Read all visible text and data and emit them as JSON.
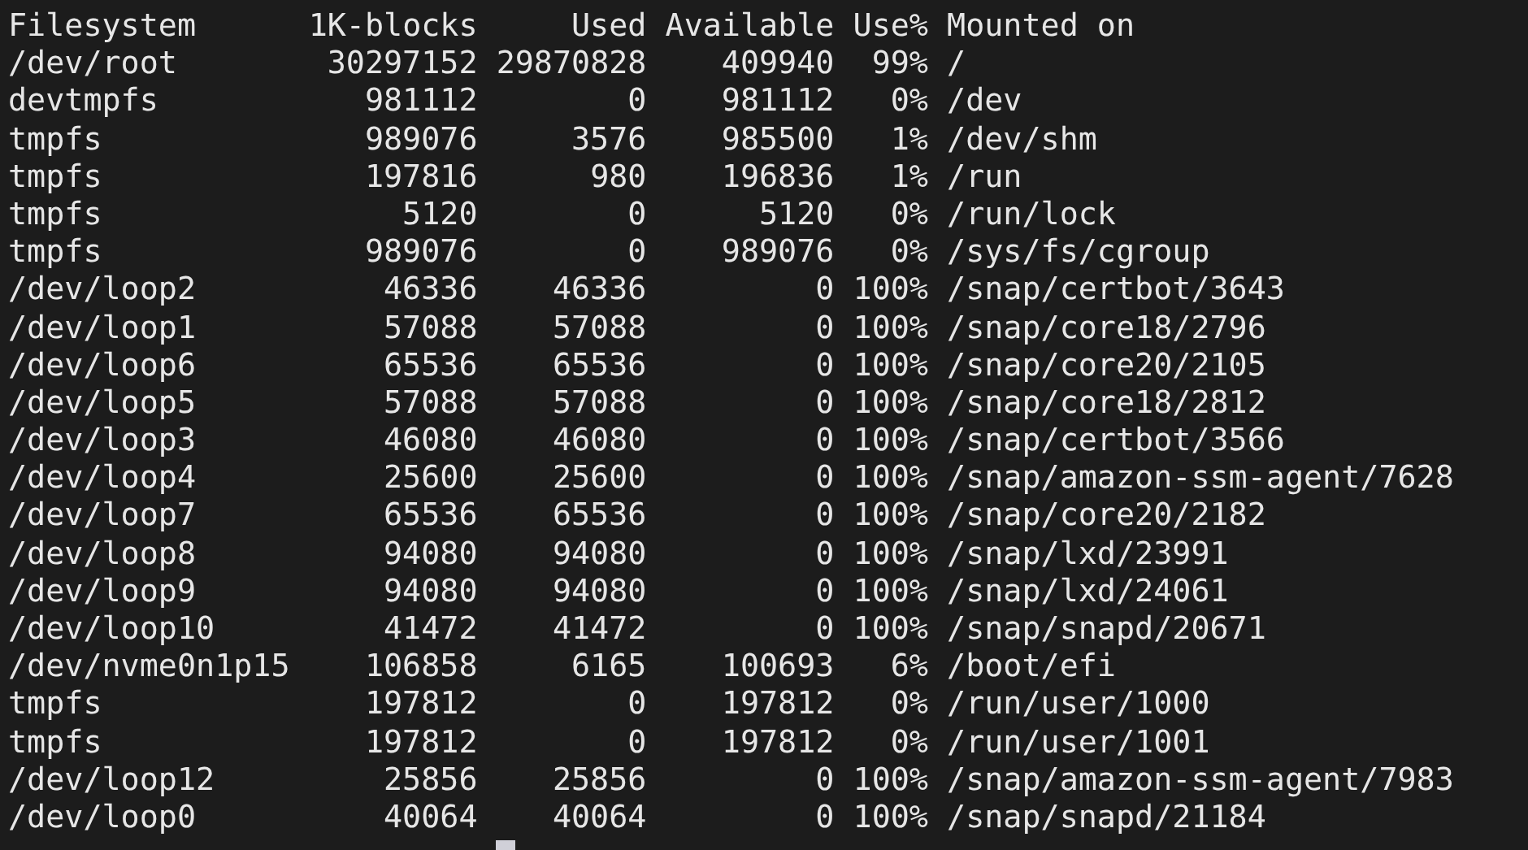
{
  "table": {
    "columns": [
      "Filesystem",
      "1K-blocks",
      "Used",
      "Available",
      "Use%",
      "Mounted on"
    ],
    "rows": [
      [
        "/dev/root",
        "30297152",
        "29870828",
        "409940",
        "99%",
        "/"
      ],
      [
        "devtmpfs",
        "981112",
        "0",
        "981112",
        "0%",
        "/dev"
      ],
      [
        "tmpfs",
        "989076",
        "3576",
        "985500",
        "1%",
        "/dev/shm"
      ],
      [
        "tmpfs",
        "197816",
        "980",
        "196836",
        "1%",
        "/run"
      ],
      [
        "tmpfs",
        "5120",
        "0",
        "5120",
        "0%",
        "/run/lock"
      ],
      [
        "tmpfs",
        "989076",
        "0",
        "989076",
        "0%",
        "/sys/fs/cgroup"
      ],
      [
        "/dev/loop2",
        "46336",
        "46336",
        "0",
        "100%",
        "/snap/certbot/3643"
      ],
      [
        "/dev/loop1",
        "57088",
        "57088",
        "0",
        "100%",
        "/snap/core18/2796"
      ],
      [
        "/dev/loop6",
        "65536",
        "65536",
        "0",
        "100%",
        "/snap/core20/2105"
      ],
      [
        "/dev/loop5",
        "57088",
        "57088",
        "0",
        "100%",
        "/snap/core18/2812"
      ],
      [
        "/dev/loop3",
        "46080",
        "46080",
        "0",
        "100%",
        "/snap/certbot/3566"
      ],
      [
        "/dev/loop4",
        "25600",
        "25600",
        "0",
        "100%",
        "/snap/amazon-ssm-agent/7628"
      ],
      [
        "/dev/loop7",
        "65536",
        "65536",
        "0",
        "100%",
        "/snap/core20/2182"
      ],
      [
        "/dev/loop8",
        "94080",
        "94080",
        "0",
        "100%",
        "/snap/lxd/23991"
      ],
      [
        "/dev/loop9",
        "94080",
        "94080",
        "0",
        "100%",
        "/snap/lxd/24061"
      ],
      [
        "/dev/loop10",
        "41472",
        "41472",
        "0",
        "100%",
        "/snap/snapd/20671"
      ],
      [
        "/dev/nvme0n1p15",
        "106858",
        "6165",
        "100693",
        "6%",
        "/boot/efi"
      ],
      [
        "tmpfs",
        "197812",
        "0",
        "197812",
        "0%",
        "/run/user/1000"
      ],
      [
        "tmpfs",
        "197812",
        "0",
        "197812",
        "0%",
        "/run/user/1001"
      ],
      [
        "/dev/loop12",
        "25856",
        "25856",
        "0",
        "100%",
        "/snap/amazon-ssm-agent/7983"
      ],
      [
        "/dev/loop0",
        "40064",
        "40064",
        "0",
        "100%",
        "/snap/snapd/21184"
      ]
    ]
  }
}
